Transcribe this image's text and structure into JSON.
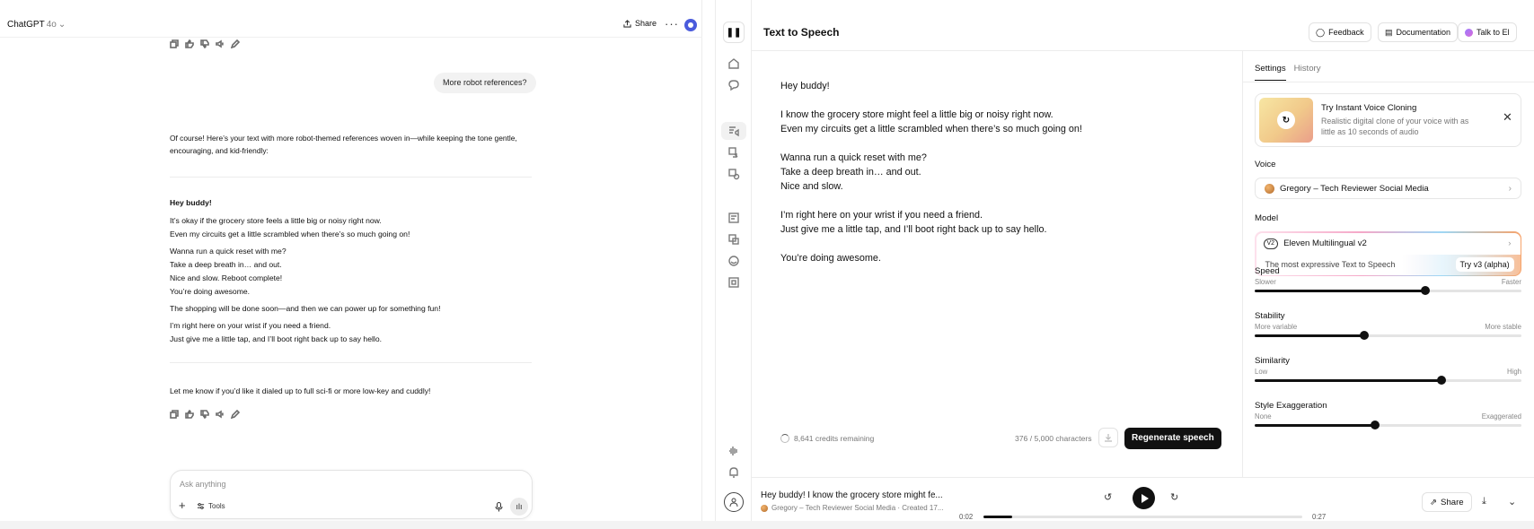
{
  "chatgpt": {
    "model": "ChatGPT",
    "model_version": "4o",
    "share_label": "Share",
    "user_message": "More robot references?",
    "intro": "Of course! Here’s your text with more robot-themed references woven in—while keeping the tone gentle, encouraging, and kid-friendly:",
    "poem": [
      "Hey buddy!",
      "It’s okay if the grocery store feels a little big or noisy right now.",
      "Even my circuits get a little scrambled when there’s so much going on!",
      "Wanna run a quick reset with me?",
      "Take a deep breath in… and out.",
      "Nice and slow. Reboot complete!",
      "You’re doing awesome.",
      "The shopping will be done soon—and then we can power up for something fun!",
      "I’m right here on your wrist if you need a friend.",
      "Just give me a little tap, and I’ll boot right back up to say hello."
    ],
    "closing": "Let me know if you’d like it dialed up to full sci-fi or more low-key and cuddly!",
    "composer": {
      "placeholder": "Ask anything",
      "tools_label": "Tools"
    }
  },
  "elevenlabs": {
    "title": "Text to Speech",
    "buttons": {
      "feedback": "Feedback",
      "documentation": "Documentation",
      "talk": "Talk to El"
    },
    "editor_lines": [
      "Hey buddy!",
      "I know the grocery store might feel a little big or noisy right now.",
      "Even my circuits get a little scrambled when there’s so much going on!",
      "Wanna run a quick reset with me?",
      "Take a deep breath in… and out.",
      "Nice and slow.",
      "I’m right here on your wrist if you need a friend.",
      "Just give me a little tap, and I’ll boot right back up to say hello.",
      "You’re doing awesome."
    ],
    "credits": "8,641 credits remaining",
    "char_count": "376 / 5,000 characters",
    "regenerate": "Regenerate speech",
    "tabs": [
      "Settings",
      "History"
    ],
    "clone_card": {
      "title": "Try Instant Voice Cloning",
      "desc": "Realistic digital clone of your voice with as little as 10 seconds of audio"
    },
    "voice_label": "Voice",
    "voice_value": "Gregory – Tech Reviewer Social Media",
    "model_label": "Model",
    "model_badge": "V2",
    "model_value": "Eleven Multilingual v2",
    "model_desc": "The most expressive Text to Speech",
    "model_cta": "Try v3 (alpha)",
    "sliders": [
      {
        "name": "Speed",
        "left": "Slower",
        "right": "Faster",
        "value": 0.64
      },
      {
        "name": "Stability",
        "left": "More variable",
        "right": "More stable",
        "value": 0.41
      },
      {
        "name": "Similarity",
        "left": "Low",
        "right": "High",
        "value": 0.7
      },
      {
        "name": "Style Exaggeration",
        "left": "None",
        "right": "Exaggerated",
        "value": 0.45
      }
    ],
    "player": {
      "title": "Hey buddy! I know the grocery store might fe...",
      "subtitle": "Gregory – Tech Reviewer Social Media · Created 17...",
      "time_current": "0:02",
      "time_total": "0:27",
      "progress": 0.09,
      "share_label": "Share"
    }
  }
}
